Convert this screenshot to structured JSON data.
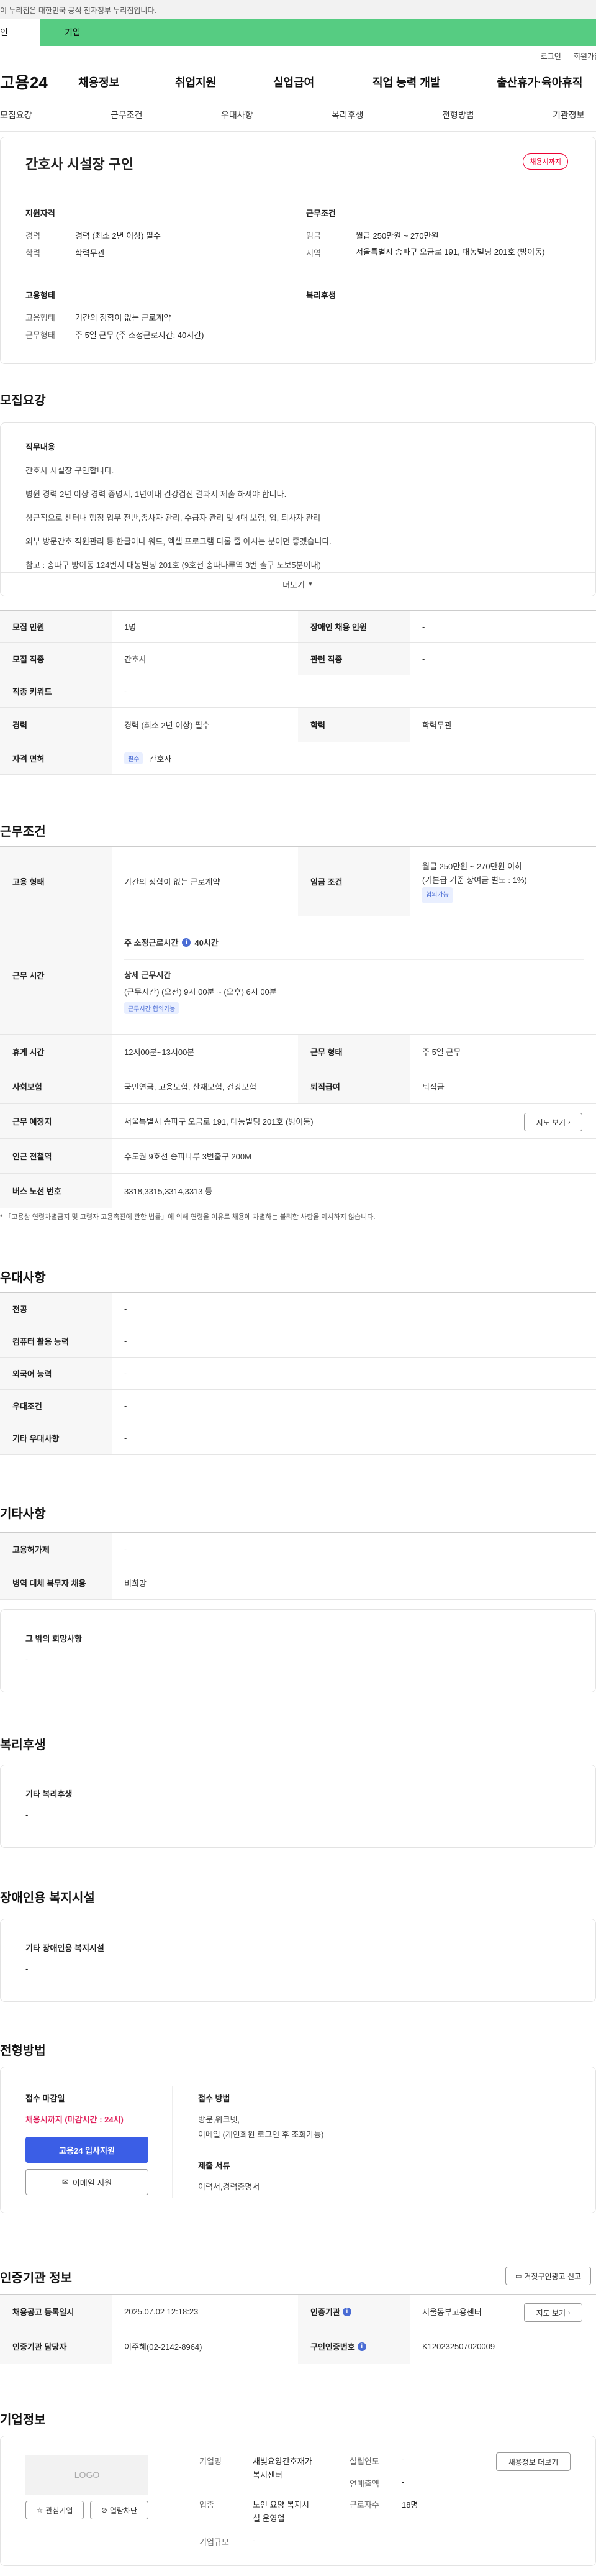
{
  "gov_notice": "이 누리집은 대한민국 공식 전자정부 누리집입니다.",
  "top_tabs": [
    "인",
    "기업"
  ],
  "util": [
    "로그인",
    "회원가입"
  ],
  "logo": "고용24",
  "gnb": [
    "채용정보",
    "취업지원",
    "실업급여",
    "직업 능력 개발",
    "출산휴가·육아휴직"
  ],
  "anchors": [
    "모집요강",
    "근무조건",
    "우대사항",
    "복리후생",
    "전형방법",
    "기관정보"
  ],
  "summary": {
    "title": "간호사 시설장 구인",
    "badge": "채용시까지",
    "left_h1": "지원자격",
    "rows1": [
      {
        "k": "경력",
        "v": "경력 (최소 2년 이상) 필수"
      },
      {
        "k": "학력",
        "v": "학력무관"
      }
    ],
    "right_h1": "근무조건",
    "rows2": [
      {
        "k": "임금",
        "v": "월급 250만원 ~ 270만원"
      },
      {
        "k": "지역",
        "v": "서울특별시 송파구 오금로 191, 대농빌딩 201호 (방이동)"
      }
    ],
    "left_h2": "고용형태",
    "rows3": [
      {
        "k": "고용형태",
        "v": "기간의 정함이 없는 근로계약"
      },
      {
        "k": "근무형태",
        "v": "주 5일 근무 (주 소정근로시간: 40시간)"
      }
    ],
    "right_h2": "복리후생"
  },
  "recruit": {
    "heading": "모집요강",
    "job_h": "직무내용",
    "lines": [
      "간호사 시설장 구인합니다.",
      "병원 경력 2년 이상 경력 증명서, 1년이내 건강검진 결과지 제출 하셔야 합니다.",
      "상근직으로 센터내 행정 업무 전반,종사자 관리, 수급자 관리 및 4대 보험, 입, 퇴사자 관리",
      "외부 방문간호 직원관리 등 한글이나 워드, 엑셀 프로그램 다룰 줄 아시는 분이면 좋겠습니다.",
      "참고 :   송파구 방이동 124번지 대농빌딩 201호 (9호선 송파나루역 3번 출구 도보5분이내)"
    ],
    "more": "더보기",
    "t1": {
      "k": "모집 인원",
      "v": "1명"
    },
    "t2": {
      "k": "장애인 채용 인원",
      "v": "-"
    },
    "t3": {
      "k": "모집 직종",
      "v": "간호사"
    },
    "t4": {
      "k": "관련 직종",
      "v": "-"
    },
    "t5": {
      "k": "직종 키워드",
      "v": "-"
    },
    "t6": {
      "k": "경력",
      "v": "경력 (최소 2년 이상) 필수"
    },
    "t7": {
      "k": "학력",
      "v": "학력무관"
    },
    "t8": {
      "k": "자격 면허",
      "tag": "필수",
      "v": "간호사"
    }
  },
  "cond": {
    "heading": "근무조건",
    "emp": {
      "k": "고용 형태",
      "v": "기간의 정함이 없는 근로계약"
    },
    "wage": {
      "k": "임금 조건",
      "v1": "월급 250만원 ~ 270만원 이하",
      "v2": "(기본급 기준 상여금 별도 : 1%)",
      "tag": "협의가능"
    },
    "time": {
      "k": "근무 시간",
      "h1": "주 소정근로시간",
      "h1v": "40시간",
      "h2": "상세 근무시간",
      "v": "(근무시간) (오전) 9시 00분 ~ (오후) 6시 00분",
      "tag": "근무시간 협의가능"
    },
    "rest": {
      "k": "휴게 시간",
      "v": "12시00분~13시00분"
    },
    "wtype": {
      "k": "근무 형태",
      "v": "주 5일 근무"
    },
    "ins": {
      "k": "사회보험",
      "v": "국민연금, 고용보험, 산재보험, 건강보험"
    },
    "ret": {
      "k": "퇴직급여",
      "v": "퇴직금"
    },
    "place": {
      "k": "근무 예정지",
      "v": "서울특별시 송파구 오금로 191, 대농빌딩 201호 (방이동)",
      "btn": "지도 보기"
    },
    "subway": {
      "k": "인근 전철역",
      "v": "수도권 9호선 송파나루 3번출구 200M"
    },
    "bus": {
      "k": "버스 노선 번호",
      "v": "3318,3315,3314,3313 등"
    },
    "note": "* 「고용상 연령차별금지 및 고령자 고용촉진에 관한 법률」에 의해 연령을 이유로 채용에 차별하는 불리한 사항을 제시하지 않습니다."
  },
  "pref": {
    "heading": "우대사항",
    "rows": [
      {
        "k": "전공",
        "v": "-"
      },
      {
        "k": "컴퓨터 활용 능력",
        "v": "-"
      },
      {
        "k": "외국어 능력",
        "v": "-"
      },
      {
        "k": "우대조건",
        "v": "-"
      },
      {
        "k": "기타 우대사항",
        "v": "-"
      }
    ]
  },
  "etc": {
    "heading": "기타사항",
    "rows": [
      {
        "k": "고용허가제",
        "v": "-"
      },
      {
        "k": "병역 대체 복무자 채용",
        "v": "비희망"
      }
    ],
    "box_h": "그 밖의 희망사항",
    "box_v": "-"
  },
  "welfare": {
    "heading": "복리후생",
    "box_h": "기타 복리후생",
    "box_v": "-"
  },
  "disabled": {
    "heading": "장애인용 복지시설",
    "box_h": "기타 장애인용 복지시설",
    "box_v": "-"
  },
  "screen": {
    "heading": "전형방법",
    "deadline_h": "접수 마감일",
    "deadline_v": "채용시까지 (마감시간 : 24시)",
    "apply_btn": "고용24 입사지원",
    "email_btn": "이메일 지원",
    "method_h": "접수 방법",
    "method_v1": "방문,워크넷,",
    "method_v2": "이메일 (개인회원 로그인 후 조회가능)",
    "docs_h": "제출 서류",
    "docs_v": "이력서,경력증명서"
  },
  "cert": {
    "heading": "인증기관 정보",
    "report_btn": "거짓구인광고 신고",
    "r1k": "채용공고 등록일시",
    "r1v": "2025.07.02 12:18:23",
    "r2k": "인증기관",
    "r2v": "서울동부고용센터",
    "map_btn": "지도 보기",
    "r3k": "인증기관 담당자",
    "r3v": "이주혜(02-2142-8964)",
    "r4k": "구인인증번호",
    "r4v": "K120232507020009"
  },
  "company": {
    "heading": "기업정보",
    "logo": "LOGO",
    "fav_btn": "관심기업",
    "block_btn": "열람차단",
    "l1": "기업명",
    "v1a": "새빛요양간호재가",
    "v1b": "복지센터",
    "l2": "업종",
    "v2a": "노인 요양 복지시",
    "v2b": "설 운영업",
    "l3": "기업규모",
    "v3": "-",
    "l4": "설립연도",
    "v4": "-",
    "l5": "연매출액",
    "v5": "-",
    "l6": "근로자수",
    "v6": "18명",
    "jobs_btn": "채용정보 더보기"
  }
}
